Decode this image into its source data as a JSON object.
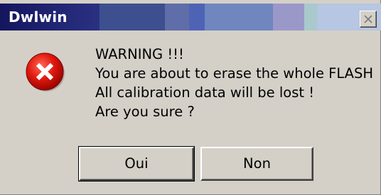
{
  "window": {
    "title": "Dwlwin",
    "titlebar_colors": [
      "#1c1c6c",
      "#2e3a8a",
      "#5b6ea2",
      "#4a62a6",
      "#7a86b0",
      "#7a92c8",
      "#9aa8d4",
      "#a8b4dc",
      "#b4c8e0",
      "#c8d8ec"
    ]
  },
  "message": {
    "lines": [
      "WARNING !!!",
      "You are about to erase the whole FLASH",
      "All calibration data will be lost !",
      "Are you sure ?"
    ]
  },
  "buttons": {
    "yes_label": "Oui",
    "no_label": "Non"
  },
  "icons": {
    "error": "error-icon",
    "close": "close-icon"
  }
}
